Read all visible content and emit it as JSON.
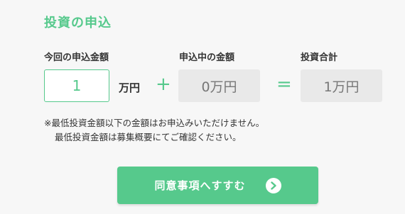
{
  "section": {
    "title": "投資の申込"
  },
  "labels": {
    "this_application": "今回の申込金額",
    "currently_applying": "申込中の金額",
    "total": "投資合計"
  },
  "input": {
    "value": "1",
    "unit": "万円"
  },
  "operators": {
    "plus": "+",
    "equals": "="
  },
  "values": {
    "currently_applying": "0万円",
    "total": "1万円"
  },
  "notes": [
    "※最低投資金額以下の金額はお申込みいただけません。",
    "最低投資金額は募集概要にてご確認ください。"
  ],
  "button": {
    "label": "同意事項へすすむ",
    "icon": "arrow-right-circle-icon"
  },
  "colors": {
    "accent": "#56c98c",
    "background": "#f7f7f7",
    "readonly_bg": "#e9e9e9"
  }
}
